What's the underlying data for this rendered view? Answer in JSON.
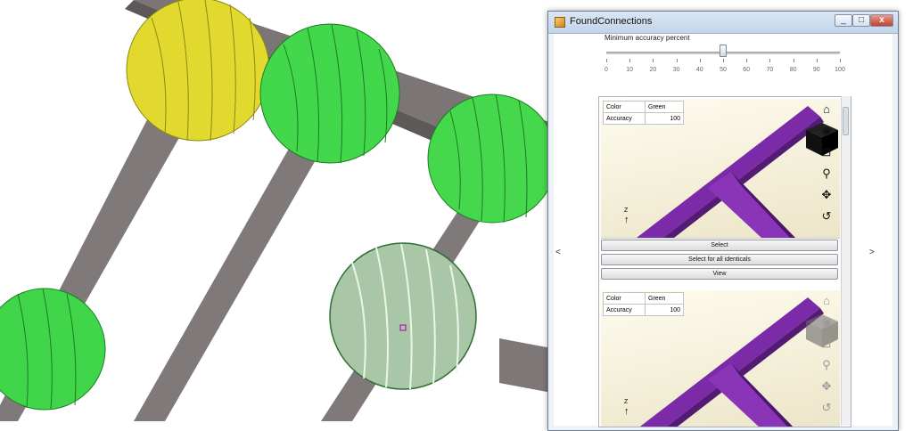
{
  "window": {
    "title": "FoundConnections",
    "min_glyph": "_",
    "max_glyph": "□",
    "close_glyph": "x"
  },
  "nav": {
    "prev": "<",
    "next": ">"
  },
  "slider": {
    "label": "Minimum accuracy percent",
    "value": 50,
    "ticks": [
      "0",
      "10",
      "20",
      "30",
      "40",
      "50",
      "60",
      "70",
      "80",
      "90",
      "100"
    ]
  },
  "connections": [
    {
      "props": [
        {
          "key": "Color",
          "value": "Green"
        },
        {
          "key": "Accuracy",
          "value": "100"
        }
      ],
      "axis_label": "Z",
      "buttons": [
        "Select",
        "Select for all identicals",
        "View"
      ]
    },
    {
      "props": [
        {
          "key": "Color",
          "value": "Green"
        },
        {
          "key": "Accuracy",
          "value": "100"
        }
      ],
      "axis_label": "Z"
    }
  ],
  "icons": [
    "home-icon",
    "orbit-icon",
    "zoom-window-icon",
    "zoom-icon",
    "pan-icon",
    "rotate-icon"
  ],
  "colors": {
    "beam": "#7e7878",
    "sphere_yellow": "#e6dc35",
    "sphere_green": "#3fd84a",
    "sphere_selected": "#a7c9a4",
    "member_purple": "#7b2aa8"
  }
}
